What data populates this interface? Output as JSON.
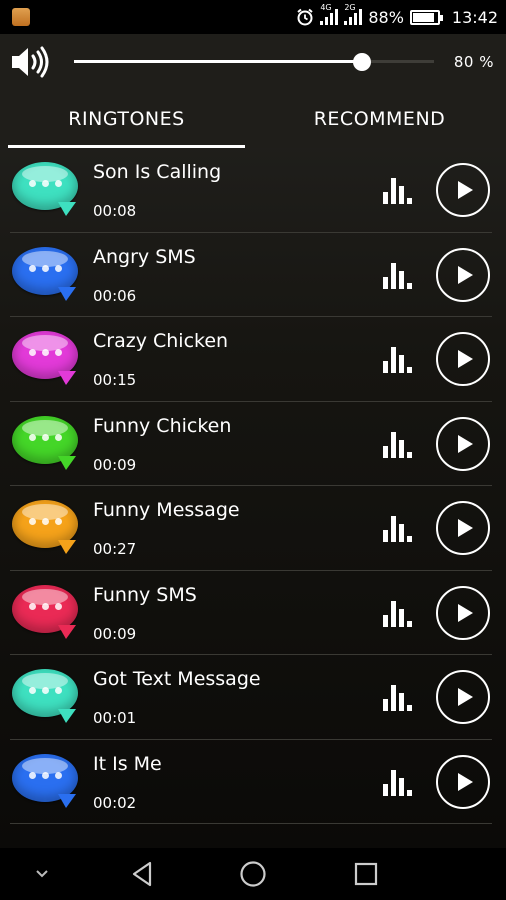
{
  "status_bar": {
    "signal1_label": "4G",
    "signal2_label": "2G",
    "battery": "88%",
    "battery_level": 0.88,
    "time": "13:42"
  },
  "volume": {
    "icon": "speaker-icon",
    "level": 0.8,
    "label": "80 %"
  },
  "tabs": [
    {
      "label": "RINGTONES",
      "active": true
    },
    {
      "label": "RECOMMEND",
      "active": false
    }
  ],
  "ringtones": [
    {
      "name": "Son Is Calling",
      "duration": "00:08",
      "color": "#3ee0c0"
    },
    {
      "name": "Angry SMS",
      "duration": "00:06",
      "color": "#2a6ff0"
    },
    {
      "name": "Crazy Chicken",
      "duration": "00:15",
      "color": "#e23ad8"
    },
    {
      "name": "Funny Chicken",
      "duration": "00:09",
      "color": "#44d628"
    },
    {
      "name": "Funny Message",
      "duration": "00:27",
      "color": "#f5a21a"
    },
    {
      "name": "Funny SMS",
      "duration": "00:09",
      "color": "#ea2a55"
    },
    {
      "name": "Got Text Message",
      "duration": "00:01",
      "color": "#3ee0c0"
    },
    {
      "name": "It Is Me",
      "duration": "00:02",
      "color": "#2a6ff0"
    }
  ],
  "nav": {
    "icons": [
      "chevron-down-icon",
      "back-icon",
      "home-icon",
      "recents-icon"
    ]
  }
}
